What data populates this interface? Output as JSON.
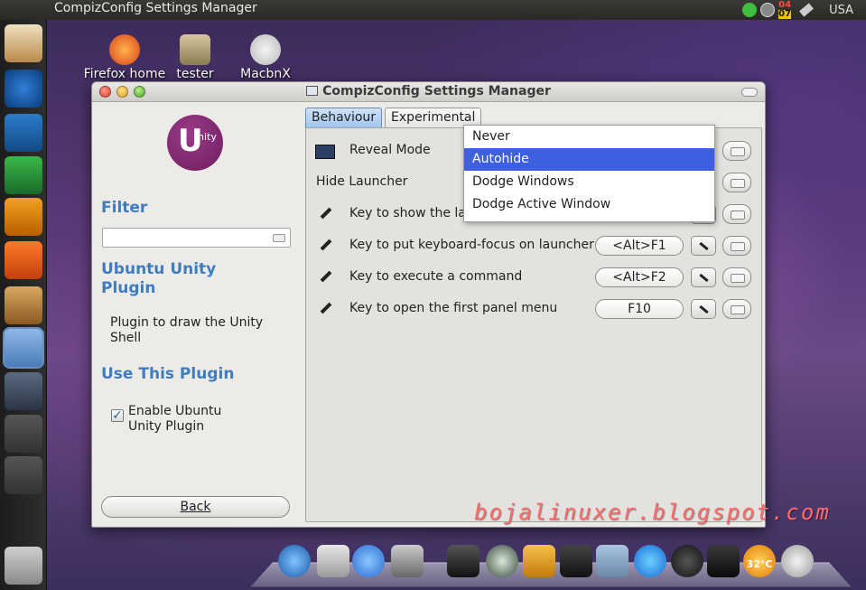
{
  "top_panel": {
    "title": "CompizConfig Settings Manager",
    "date_top": "04",
    "date_bottom": "07",
    "keyboard_layout": "USA"
  },
  "desktop_icons": [
    {
      "label": "Firefox home"
    },
    {
      "label": "tester"
    },
    {
      "label": "MacbnX Remix"
    }
  ],
  "window": {
    "title": "CompizConfig Settings Manager",
    "sidebar": {
      "logo_u": "U",
      "logo_text": "nity",
      "filter_heading": "Filter",
      "filter_value": "",
      "plugin_heading": "Ubuntu Unity Plugin",
      "plugin_description": "Plugin to draw the Unity Shell",
      "use_heading": "Use This Plugin",
      "enable_label": "Enable Ubuntu Unity Plugin",
      "enable_checked": true,
      "back_label": "Back"
    },
    "tabs": [
      {
        "label": "Behaviour",
        "active": true
      },
      {
        "label": "Experimental",
        "active": false
      }
    ],
    "settings": [
      {
        "label": "Reveal Mode"
      },
      {
        "label": "Hide Launcher"
      },
      {
        "label": "Key to show the launcher",
        "visible_label": "Key to show the lau"
      },
      {
        "label": "Key to put keyboard-focus on launcher",
        "key": "<Alt>F1"
      },
      {
        "label": "Key to execute a command",
        "key": "<Alt>F2"
      },
      {
        "label": "Key to open the first panel menu",
        "key": "F10"
      }
    ],
    "dropdown": {
      "options": [
        "Never",
        "Autohide",
        "Dodge Windows",
        "Dodge Active Window"
      ],
      "selected": "Autohide"
    }
  },
  "dock": {
    "temperature": "32°C"
  },
  "watermark": "bojalinuxer.blogspot.com",
  "colors": {
    "accent": "#3f7dbf",
    "selection": "#3d5fe0",
    "unity_purple": "#7a2468"
  }
}
